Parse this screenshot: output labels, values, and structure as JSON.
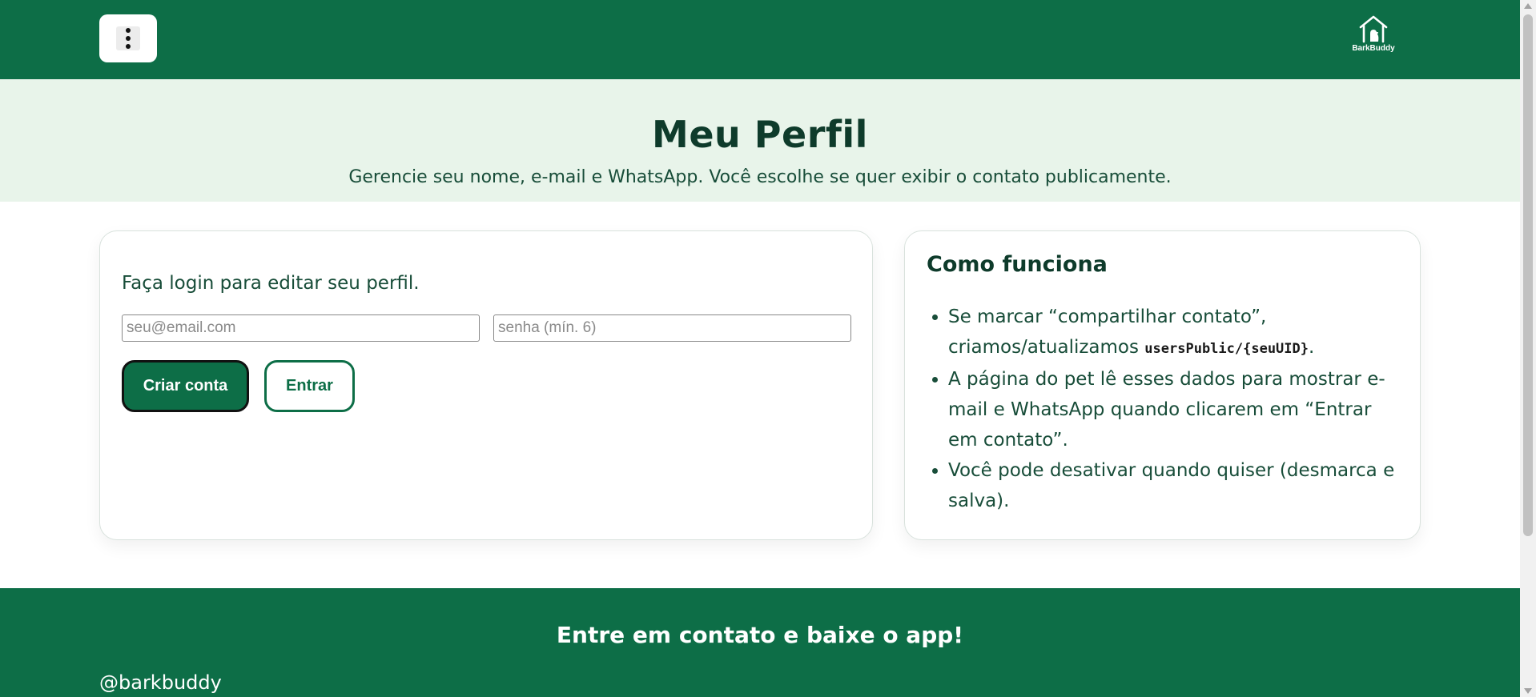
{
  "header": {
    "menu_icon": "kebab-menu-icon",
    "logo_text": "BarkBuddy",
    "logo_icon": "dog-house-icon"
  },
  "hero": {
    "title": "Meu Perfil",
    "subtitle": "Gerencie seu nome, e-mail e WhatsApp. Você escolhe se quer exibir o contato publicamente."
  },
  "login": {
    "prompt": "Faça login para editar seu perfil.",
    "email_placeholder": "seu@email.com",
    "email_value": "",
    "password_placeholder": "senha (mín. 6)",
    "password_value": "",
    "create_label": "Criar conta",
    "enter_label": "Entrar"
  },
  "how_it_works": {
    "title": "Como funciona",
    "item1_text": "Se marcar “compartilhar contato”, criamos/atualizamos ",
    "item1_code": "usersPublic/{seuUID}",
    "item1_end": ".",
    "item2": "A página do pet lê esses dados para mostrar e-mail e WhatsApp quando clicarem em “Entrar em contato”.",
    "item3": "Você pode desativar quando quiser (desmarca e salva)."
  },
  "footer": {
    "title": "Entre em contato e baixe o app!",
    "handle": "@barkbuddy"
  },
  "colors": {
    "brand_green": "#0d6e47",
    "hero_bg": "#e8f4ea",
    "text_dark": "#0e3b2b"
  }
}
